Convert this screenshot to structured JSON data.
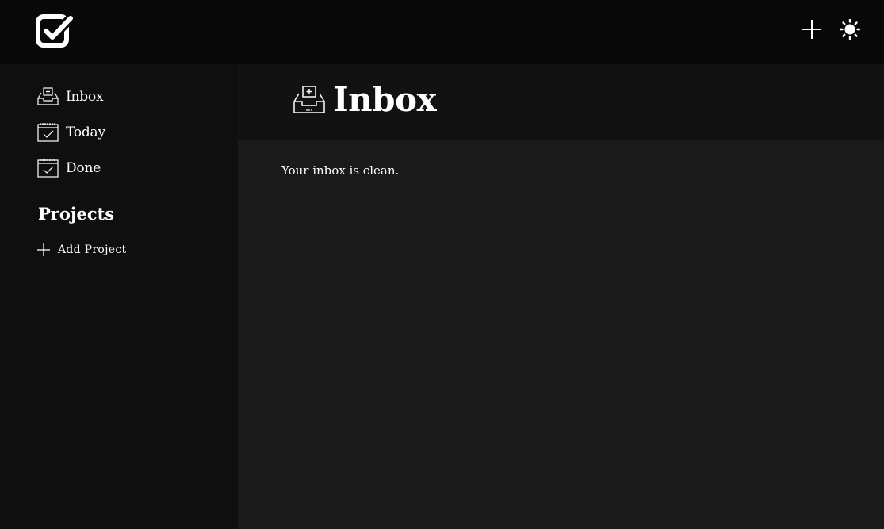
{
  "topbar": {
    "logo_icon": "checkbox-logo-icon",
    "add_icon": "plus-icon",
    "theme_icon": "sun-icon"
  },
  "sidebar": {
    "items": [
      {
        "label": "Inbox",
        "icon": "inbox-icon"
      },
      {
        "label": "Today",
        "icon": "calendar-check-icon"
      },
      {
        "label": "Done",
        "icon": "calendar-check-icon"
      }
    ],
    "projects_heading": "Projects",
    "add_project_label": "Add Project"
  },
  "main": {
    "title": "Inbox",
    "title_icon": "inbox-icon",
    "empty_message": "Your inbox is clean."
  },
  "colors": {
    "topbar_bg": "#080808",
    "sidebar_bg": "#0f0f0f",
    "main_header_bg": "#121212",
    "main_bg": "#1a1a1a",
    "text": "#ffffff"
  }
}
